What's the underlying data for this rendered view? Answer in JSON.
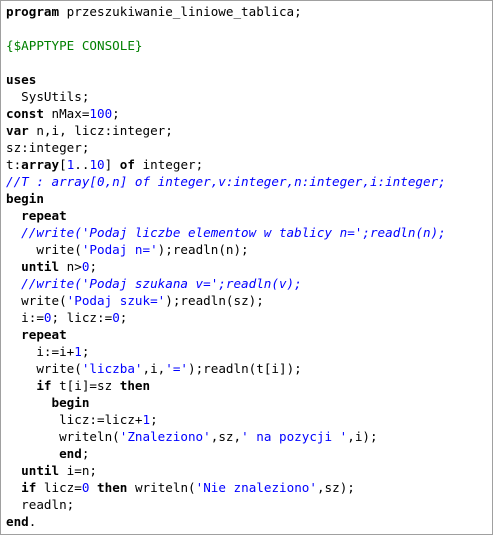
{
  "editor": {
    "lines": [
      [
        {
          "t": "kw",
          "v": "program"
        },
        {
          "t": "txt",
          "v": " przeszukiwanie_liniowe_tablica;"
        }
      ],
      [],
      [
        {
          "t": "dir",
          "v": "{$APPTYPE CONSOLE}"
        }
      ],
      [],
      [
        {
          "t": "kw",
          "v": "uses"
        }
      ],
      [
        {
          "t": "txt",
          "v": "  SysUtils;"
        }
      ],
      [
        {
          "t": "kw",
          "v": "const"
        },
        {
          "t": "txt",
          "v": " nMax="
        },
        {
          "t": "num",
          "v": "100"
        },
        {
          "t": "txt",
          "v": ";"
        }
      ],
      [
        {
          "t": "kw",
          "v": "var"
        },
        {
          "t": "txt",
          "v": " n,i, licz:integer;"
        }
      ],
      [
        {
          "t": "txt",
          "v": "sz:integer;"
        }
      ],
      [
        {
          "t": "txt",
          "v": "t:"
        },
        {
          "t": "kw",
          "v": "array"
        },
        {
          "t": "txt",
          "v": "["
        },
        {
          "t": "num",
          "v": "1"
        },
        {
          "t": "txt",
          "v": ".."
        },
        {
          "t": "num",
          "v": "10"
        },
        {
          "t": "txt",
          "v": "] "
        },
        {
          "t": "kw",
          "v": "of"
        },
        {
          "t": "txt",
          "v": " integer;"
        }
      ],
      [
        {
          "t": "cmt",
          "v": "//T : array[0,n] of integer,v:integer,n:integer,i:integer;"
        }
      ],
      [
        {
          "t": "kw",
          "v": "begin"
        }
      ],
      [
        {
          "t": "txt",
          "v": "  "
        },
        {
          "t": "kw",
          "v": "repeat"
        }
      ],
      [
        {
          "t": "txt",
          "v": "  "
        },
        {
          "t": "cmt",
          "v": "//write('Podaj liczbe elementow w tablicy n=';readln(n);"
        }
      ],
      [
        {
          "t": "txt",
          "v": "    write("
        },
        {
          "t": "str",
          "v": "'Podaj n='"
        },
        {
          "t": "txt",
          "v": ");readln(n);"
        }
      ],
      [
        {
          "t": "txt",
          "v": "  "
        },
        {
          "t": "kw",
          "v": "until"
        },
        {
          "t": "txt",
          "v": " n>"
        },
        {
          "t": "num",
          "v": "0"
        },
        {
          "t": "txt",
          "v": ";"
        }
      ],
      [
        {
          "t": "txt",
          "v": "  "
        },
        {
          "t": "cmt",
          "v": "//write('Podaj szukana v=';readln(v);"
        }
      ],
      [
        {
          "t": "txt",
          "v": "  write("
        },
        {
          "t": "str",
          "v": "'Podaj szuk='"
        },
        {
          "t": "txt",
          "v": ");readln(sz);"
        }
      ],
      [
        {
          "t": "txt",
          "v": "  i:="
        },
        {
          "t": "num",
          "v": "0"
        },
        {
          "t": "txt",
          "v": "; licz:="
        },
        {
          "t": "num",
          "v": "0"
        },
        {
          "t": "txt",
          "v": ";"
        }
      ],
      [
        {
          "t": "txt",
          "v": "  "
        },
        {
          "t": "kw",
          "v": "repeat"
        }
      ],
      [
        {
          "t": "txt",
          "v": "    i:=i+"
        },
        {
          "t": "num",
          "v": "1"
        },
        {
          "t": "txt",
          "v": ";"
        }
      ],
      [
        {
          "t": "txt",
          "v": "    write("
        },
        {
          "t": "str",
          "v": "'liczba'"
        },
        {
          "t": "txt",
          "v": ",i,"
        },
        {
          "t": "str",
          "v": "'='"
        },
        {
          "t": "txt",
          "v": ");readln(t[i]);"
        }
      ],
      [
        {
          "t": "txt",
          "v": "    "
        },
        {
          "t": "kw",
          "v": "if"
        },
        {
          "t": "txt",
          "v": " t[i]=sz "
        },
        {
          "t": "kw",
          "v": "then"
        }
      ],
      [
        {
          "t": "txt",
          "v": "      "
        },
        {
          "t": "kw",
          "v": "begin"
        }
      ],
      [
        {
          "t": "txt",
          "v": "       licz:=licz+"
        },
        {
          "t": "num",
          "v": "1"
        },
        {
          "t": "txt",
          "v": ";"
        }
      ],
      [
        {
          "t": "txt",
          "v": "       writeln("
        },
        {
          "t": "str",
          "v": "'Znaleziono'"
        },
        {
          "t": "txt",
          "v": ",sz,"
        },
        {
          "t": "str",
          "v": "' na pozycji '"
        },
        {
          "t": "txt",
          "v": ",i);"
        }
      ],
      [
        {
          "t": "txt",
          "v": "       "
        },
        {
          "t": "kw",
          "v": "end"
        },
        {
          "t": "txt",
          "v": ";"
        }
      ],
      [
        {
          "t": "txt",
          "v": "  "
        },
        {
          "t": "kw",
          "v": "until"
        },
        {
          "t": "txt",
          "v": " i=n;"
        }
      ],
      [
        {
          "t": "txt",
          "v": "  "
        },
        {
          "t": "kw",
          "v": "if"
        },
        {
          "t": "txt",
          "v": " licz="
        },
        {
          "t": "num",
          "v": "0"
        },
        {
          "t": "txt",
          "v": " "
        },
        {
          "t": "kw",
          "v": "then"
        },
        {
          "t": "txt",
          "v": " writeln("
        },
        {
          "t": "str",
          "v": "'Nie znaleziono'"
        },
        {
          "t": "txt",
          "v": ",sz);"
        }
      ],
      [
        {
          "t": "txt",
          "v": "  readln;"
        }
      ],
      [
        {
          "t": "kw",
          "v": "end"
        },
        {
          "t": "txt",
          "v": "."
        }
      ]
    ]
  },
  "colors": {
    "keyword": "#000000",
    "string": "#0000ff",
    "number": "#0000ff",
    "directive": "#008000",
    "comment": "#0000ff"
  }
}
